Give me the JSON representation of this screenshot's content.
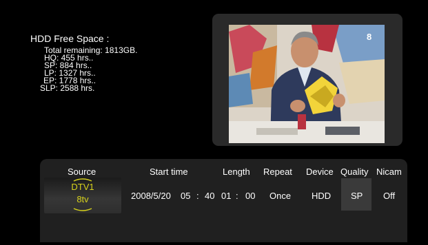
{
  "hdd": {
    "title": "HDD Free Space :",
    "lines": [
      "Total remaining: 1813GB.",
      "HQ: 455 hrs..",
      "SP: 884 hrs..",
      "LP: 1327 hrs..",
      "EP: 1778 hrs..",
      "SLP: 2588 hrs."
    ]
  },
  "preview": {
    "channel_badge": "8"
  },
  "record": {
    "headers": {
      "source": "Source",
      "start_time": "Start time",
      "length": "Length",
      "repeat": "Repeat",
      "device": "Device",
      "quality": "Quality",
      "nicam": "Nicam"
    },
    "source": {
      "line1": "DTV1",
      "line2": "8tv"
    },
    "date": "2008/5/20",
    "start_hour": "05",
    "time_sep": ":",
    "start_min": "40",
    "length_hour": "01",
    "length_min": "00",
    "repeat": "Once",
    "device": "HDD",
    "quality": "SP",
    "nicam": "Off"
  },
  "colors": {
    "accent": "#d7d21c",
    "panel": "#202020",
    "background": "#000000"
  }
}
